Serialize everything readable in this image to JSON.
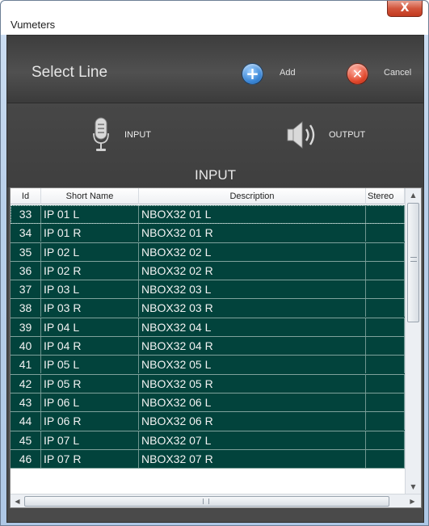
{
  "window": {
    "title": "Vumeters",
    "close_glyph": "X"
  },
  "toolbar": {
    "title": "Select Line",
    "add_label": "Add",
    "add_icon": "plus-icon",
    "cancel_label": "Cancel",
    "cancel_icon": "x-icon"
  },
  "modes": {
    "input_label": "INPUT",
    "output_label": "OUTPUT",
    "input_icon": "microphone-icon",
    "output_icon": "speaker-icon"
  },
  "section_heading": "INPUT",
  "table": {
    "columns": [
      "Id",
      "Short Name",
      "Description",
      "Stereo"
    ],
    "rows": [
      {
        "id": "33",
        "short": "IP 01 L",
        "desc": "NBOX32 01 L",
        "stereo": ""
      },
      {
        "id": "34",
        "short": "IP 01 R",
        "desc": "NBOX32 01 R",
        "stereo": ""
      },
      {
        "id": "35",
        "short": "IP 02 L",
        "desc": "NBOX32 02 L",
        "stereo": ""
      },
      {
        "id": "36",
        "short": "IP 02 R",
        "desc": "NBOX32 02 R",
        "stereo": ""
      },
      {
        "id": "37",
        "short": "IP 03 L",
        "desc": "NBOX32 03 L",
        "stereo": ""
      },
      {
        "id": "38",
        "short": "IP 03 R",
        "desc": "NBOX32 03 R",
        "stereo": ""
      },
      {
        "id": "39",
        "short": "IP 04 L",
        "desc": "NBOX32 04 L",
        "stereo": ""
      },
      {
        "id": "40",
        "short": "IP 04 R",
        "desc": "NBOX32 04 R",
        "stereo": ""
      },
      {
        "id": "41",
        "short": "IP 05 L",
        "desc": "NBOX32 05 L",
        "stereo": ""
      },
      {
        "id": "42",
        "short": "IP 05 R",
        "desc": "NBOX32 05 R",
        "stereo": ""
      },
      {
        "id": "43",
        "short": "IP 06 L",
        "desc": "NBOX32 06 L",
        "stereo": ""
      },
      {
        "id": "44",
        "short": "IP 06 R",
        "desc": "NBOX32 06 R",
        "stereo": ""
      },
      {
        "id": "45",
        "short": "IP 07 L",
        "desc": "NBOX32 07 L",
        "stereo": ""
      },
      {
        "id": "46",
        "short": "IP 07 R",
        "desc": "NBOX32 07 R",
        "stereo": ""
      }
    ]
  },
  "colors": {
    "row_bg": "#02433c",
    "panel_bg": "#4a4a4a",
    "accent_add": "#3a86d6",
    "accent_cancel": "#e2472b"
  }
}
